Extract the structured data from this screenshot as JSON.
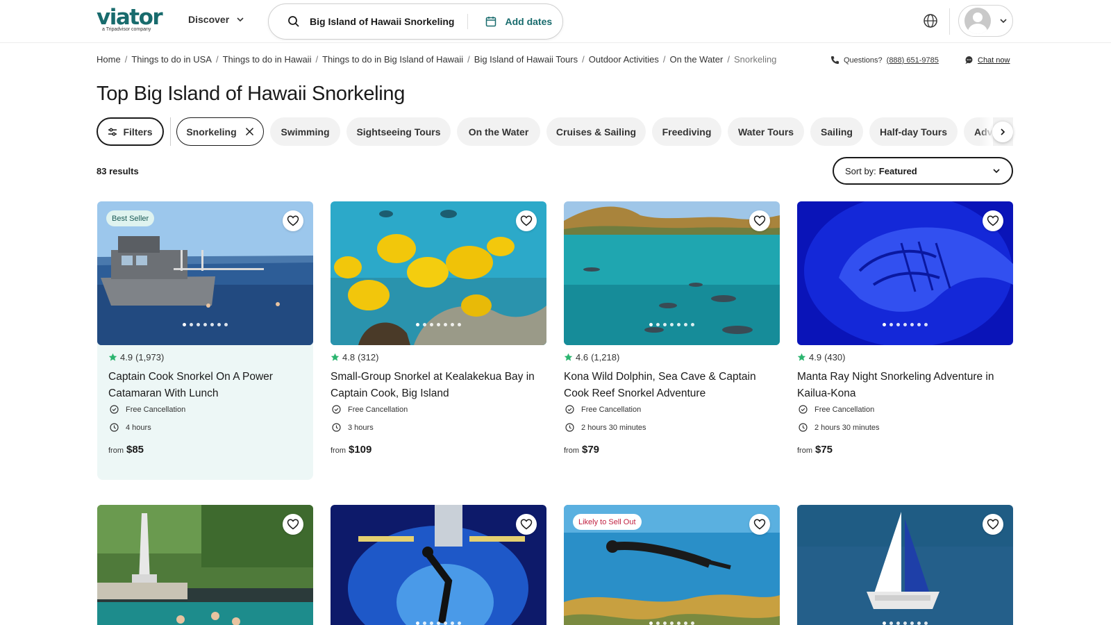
{
  "header": {
    "logo_text": "viator",
    "logo_sub": "a Tripadvisor company",
    "discover_label": "Discover",
    "search_query": "Big Island of Hawaii Snorkeling",
    "dates_label": "Add dates"
  },
  "breadcrumb": [
    "Home",
    "Things to do in USA",
    "Things to do in Hawaii",
    "Things to do in Big Island of Hawaii",
    "Big Island of Hawaii Tours",
    "Outdoor Activities",
    "On the Water",
    "Snorkeling"
  ],
  "contact": {
    "questions_label": "Questions?",
    "phone": "(888) 651-9785",
    "chat_label": "Chat now"
  },
  "page_title": "Top Big Island of Hawaii Snorkeling",
  "filters": {
    "filters_label": "Filters",
    "active_chip": "Snorkeling",
    "chips": [
      "Swimming",
      "Sightseeing Tours",
      "On the Water",
      "Cruises & Sailing",
      "Freediving",
      "Water Tours",
      "Sailing",
      "Half-day Tours",
      "Adventure Tours"
    ]
  },
  "results_count": "83 results",
  "sort": {
    "label": "Sort by:",
    "value": "Featured"
  },
  "products": [
    {
      "badge": "Best Seller",
      "rating": "4.9",
      "reviews": "(1,973)",
      "title": "Captain Cook Snorkel On A Power Catamaran With Lunch",
      "cancellation": "Free Cancellation",
      "duration": "4 hours",
      "from_label": "from",
      "price": "$85"
    },
    {
      "rating": "4.8",
      "reviews": "(312)",
      "title": "Small-Group Snorkel at Kealakekua Bay in Captain Cook, Big Island",
      "cancellation": "Free Cancellation",
      "duration": "3 hours",
      "from_label": "from",
      "price": "$109"
    },
    {
      "rating": "4.6",
      "reviews": "(1,218)",
      "title": "Kona Wild Dolphin, Sea Cave & Captain Cook Reef Snorkel Adventure",
      "cancellation": "Free Cancellation",
      "duration": "2 hours 30 minutes",
      "from_label": "from",
      "price": "$79"
    },
    {
      "rating": "4.9",
      "reviews": "(430)",
      "title": "Manta Ray Night Snorkeling Adventure in Kailua-Kona",
      "cancellation": "Free Cancellation",
      "duration": "2 hours 30 minutes",
      "from_label": "from",
      "price": "$75"
    },
    {},
    {},
    {
      "badge": "Likely to Sell Out"
    },
    {}
  ],
  "colors": {
    "brand": "#186b6d",
    "rating_star": "#2bb56f",
    "highlight_card": "#edf7f6",
    "sell_out": "#c02040"
  }
}
